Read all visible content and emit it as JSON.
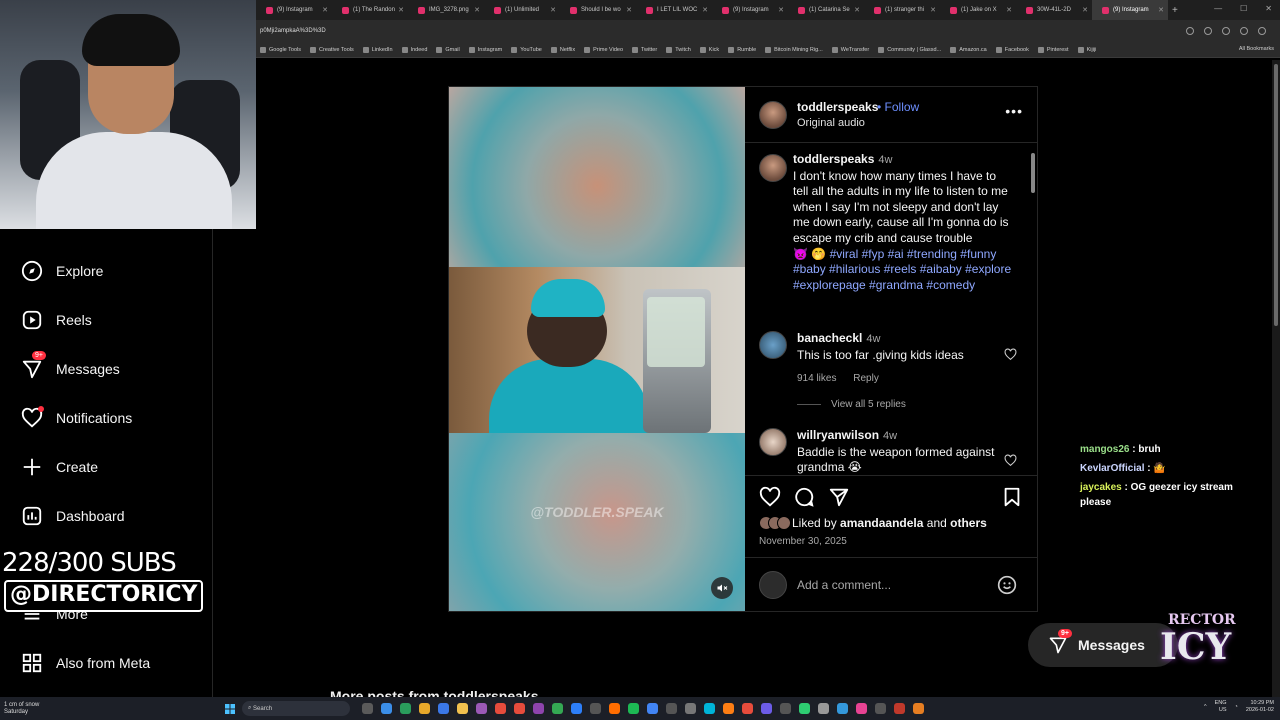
{
  "browser": {
    "tabs": [
      {
        "label": "(9) Instagram",
        "active": false
      },
      {
        "label": "(1) The Randon",
        "active": false
      },
      {
        "label": "IMG_3278.png",
        "active": false
      },
      {
        "label": "(1) Unlimited",
        "active": false
      },
      {
        "label": "Should I be wo",
        "active": false
      },
      {
        "label": "I LET LIL WOC",
        "active": false
      },
      {
        "label": "(9) Instagram",
        "active": false
      },
      {
        "label": "(1) Catarina Se",
        "active": false
      },
      {
        "label": "(1) stranger thi",
        "active": false
      },
      {
        "label": "(1) Jake on X",
        "active": false
      },
      {
        "label": "30W-41L-2D",
        "active": false
      },
      {
        "label": "(9) Instagram",
        "active": true
      }
    ],
    "url": "p0Mji2ampkaA%3D%3D",
    "bookmarks": [
      "Google Tools",
      "Creative Tools",
      "LinkedIn",
      "Indeed",
      "Gmail",
      "Instagram",
      "YouTube",
      "Netflix",
      "Prime Video",
      "Twitter",
      "Twitch",
      "Kick",
      "Rumble",
      "Bitcoin Mining Rig...",
      "WeTransfer",
      "Community | Glassd...",
      "Amazon.ca",
      "Facebook",
      "Pinterest",
      "Kijiji"
    ],
    "all_bookmarks": "All Bookmarks"
  },
  "nav": {
    "explore": "Explore",
    "reels": "Reels",
    "messages": "Messages",
    "messages_badge": "9+",
    "notifications": "Notifications",
    "create": "Create",
    "dashboard": "Dashboard",
    "more": "More",
    "also_from_meta": "Also from Meta"
  },
  "overlay": {
    "subs": "228/300 SUBS",
    "handle": "@DIRECTORICY"
  },
  "post": {
    "username": "toddlerspeaks",
    "follow": "Follow",
    "audio": "Original audio",
    "watermark": "@TODDLER.SPEAK",
    "caption": {
      "user": "toddlerspeaks",
      "time": "4w",
      "text": "I don't know how many times I have to tell all the adults in my life to listen to me when I say I'm not sleepy and don't lay me down early, cause all I'm gonna do is escape my crib and cause trouble",
      "emoji": "👿 🤭",
      "tags": "#viral #fyp #ai #trending #funny #baby #hilarious #reels #aibaby #explore #explorepage #grandma #comedy"
    },
    "comments": [
      {
        "user": "banacheckl",
        "time": "4w",
        "text": "This is too far .giving kids ideas",
        "likes": "914 likes",
        "reply": "Reply"
      },
      {
        "user": "willryanwilson",
        "time": "4w",
        "text": "Baddie is the weapon formed against grandma 😭"
      }
    ],
    "view_replies": "View all 5 replies",
    "liked_by_prefix": "Liked by",
    "liked_by_user": "amandaandela",
    "liked_by_and": "and",
    "liked_by_others": "others",
    "date": "November 30, 2025",
    "add_comment_placeholder": "Add a comment..."
  },
  "chat": [
    {
      "user": "mangos26",
      "text": "bruh"
    },
    {
      "user": "KevlarOfficial",
      "text": "🤷"
    },
    {
      "user": "jaycakes",
      "text": "OG geezer icy stream please"
    }
  ],
  "floating_messages": {
    "label": "Messages",
    "badge": "9+"
  },
  "logo": {
    "top": "RECTOR",
    "main": "ICY"
  },
  "below_post": "More posts from toddlerspeaks",
  "taskbar": {
    "weather_line1": "1 cm of snow",
    "weather_line2": "Saturday",
    "search": "Search",
    "lang1": "ENG",
    "lang2": "US",
    "time": "10:29 PM",
    "date": "2026-01-02"
  },
  "colors": {
    "link": "#6d8fff",
    "badge": "#ff3040",
    "bg": "#000000"
  }
}
